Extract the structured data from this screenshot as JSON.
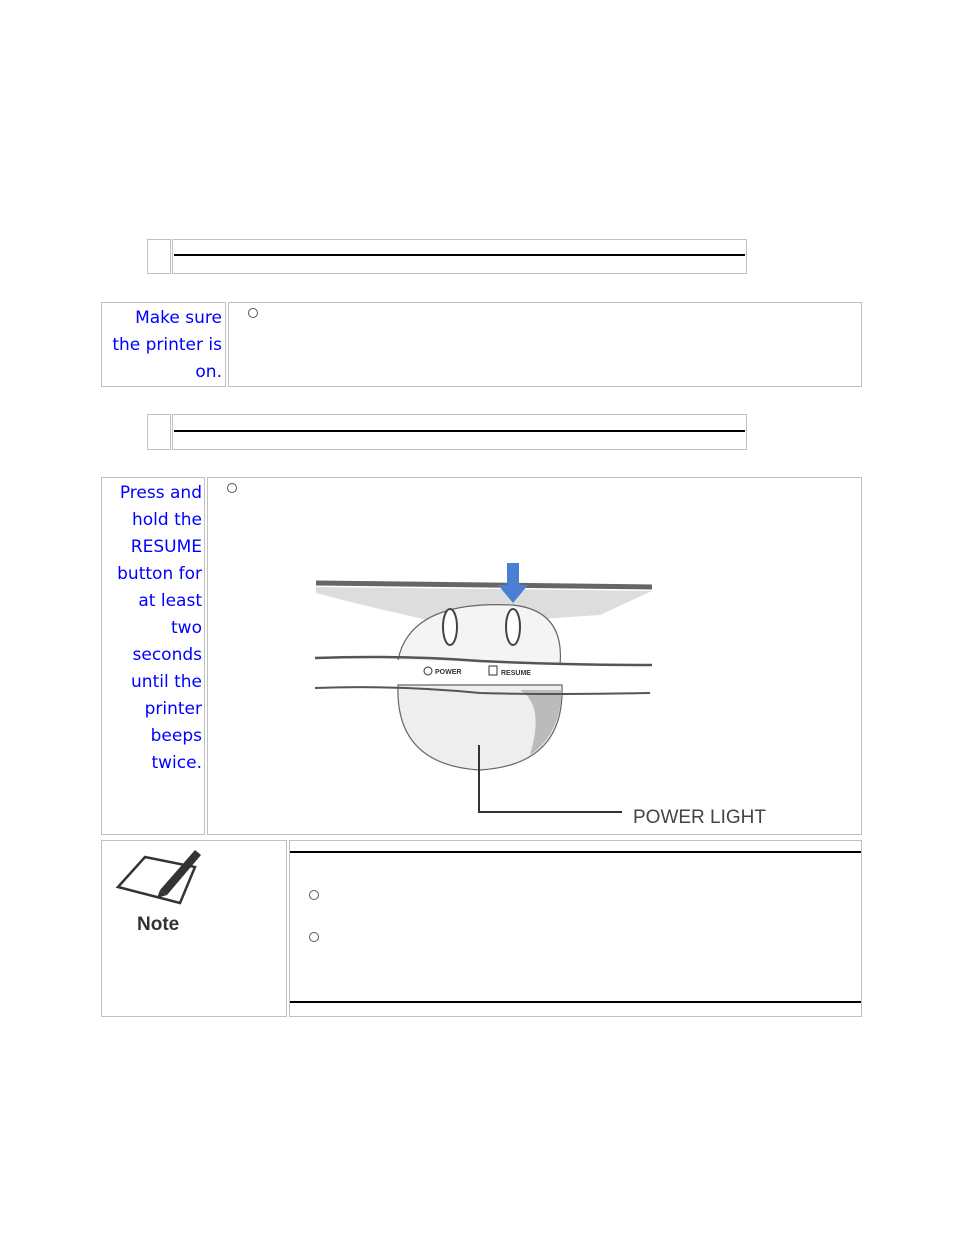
{
  "steps": [
    {
      "text_lines": [
        "Make sure",
        "the printer is",
        "on."
      ]
    },
    {
      "text_lines": [
        "Press and",
        "hold the",
        "RESUME",
        "button for",
        "at least",
        "two",
        "seconds",
        "until the",
        "printer",
        "beeps",
        "twice."
      ]
    }
  ],
  "figure": {
    "button_labels": [
      "POWER",
      "RESUME"
    ],
    "callout": "POWER LIGHT",
    "arrow_color": "#4a7fd4"
  },
  "note": {
    "label": "Note",
    "icon": "note-pencil-icon"
  },
  "colors": {
    "step_text": "#0000ff",
    "border": "#c0c0c0"
  }
}
